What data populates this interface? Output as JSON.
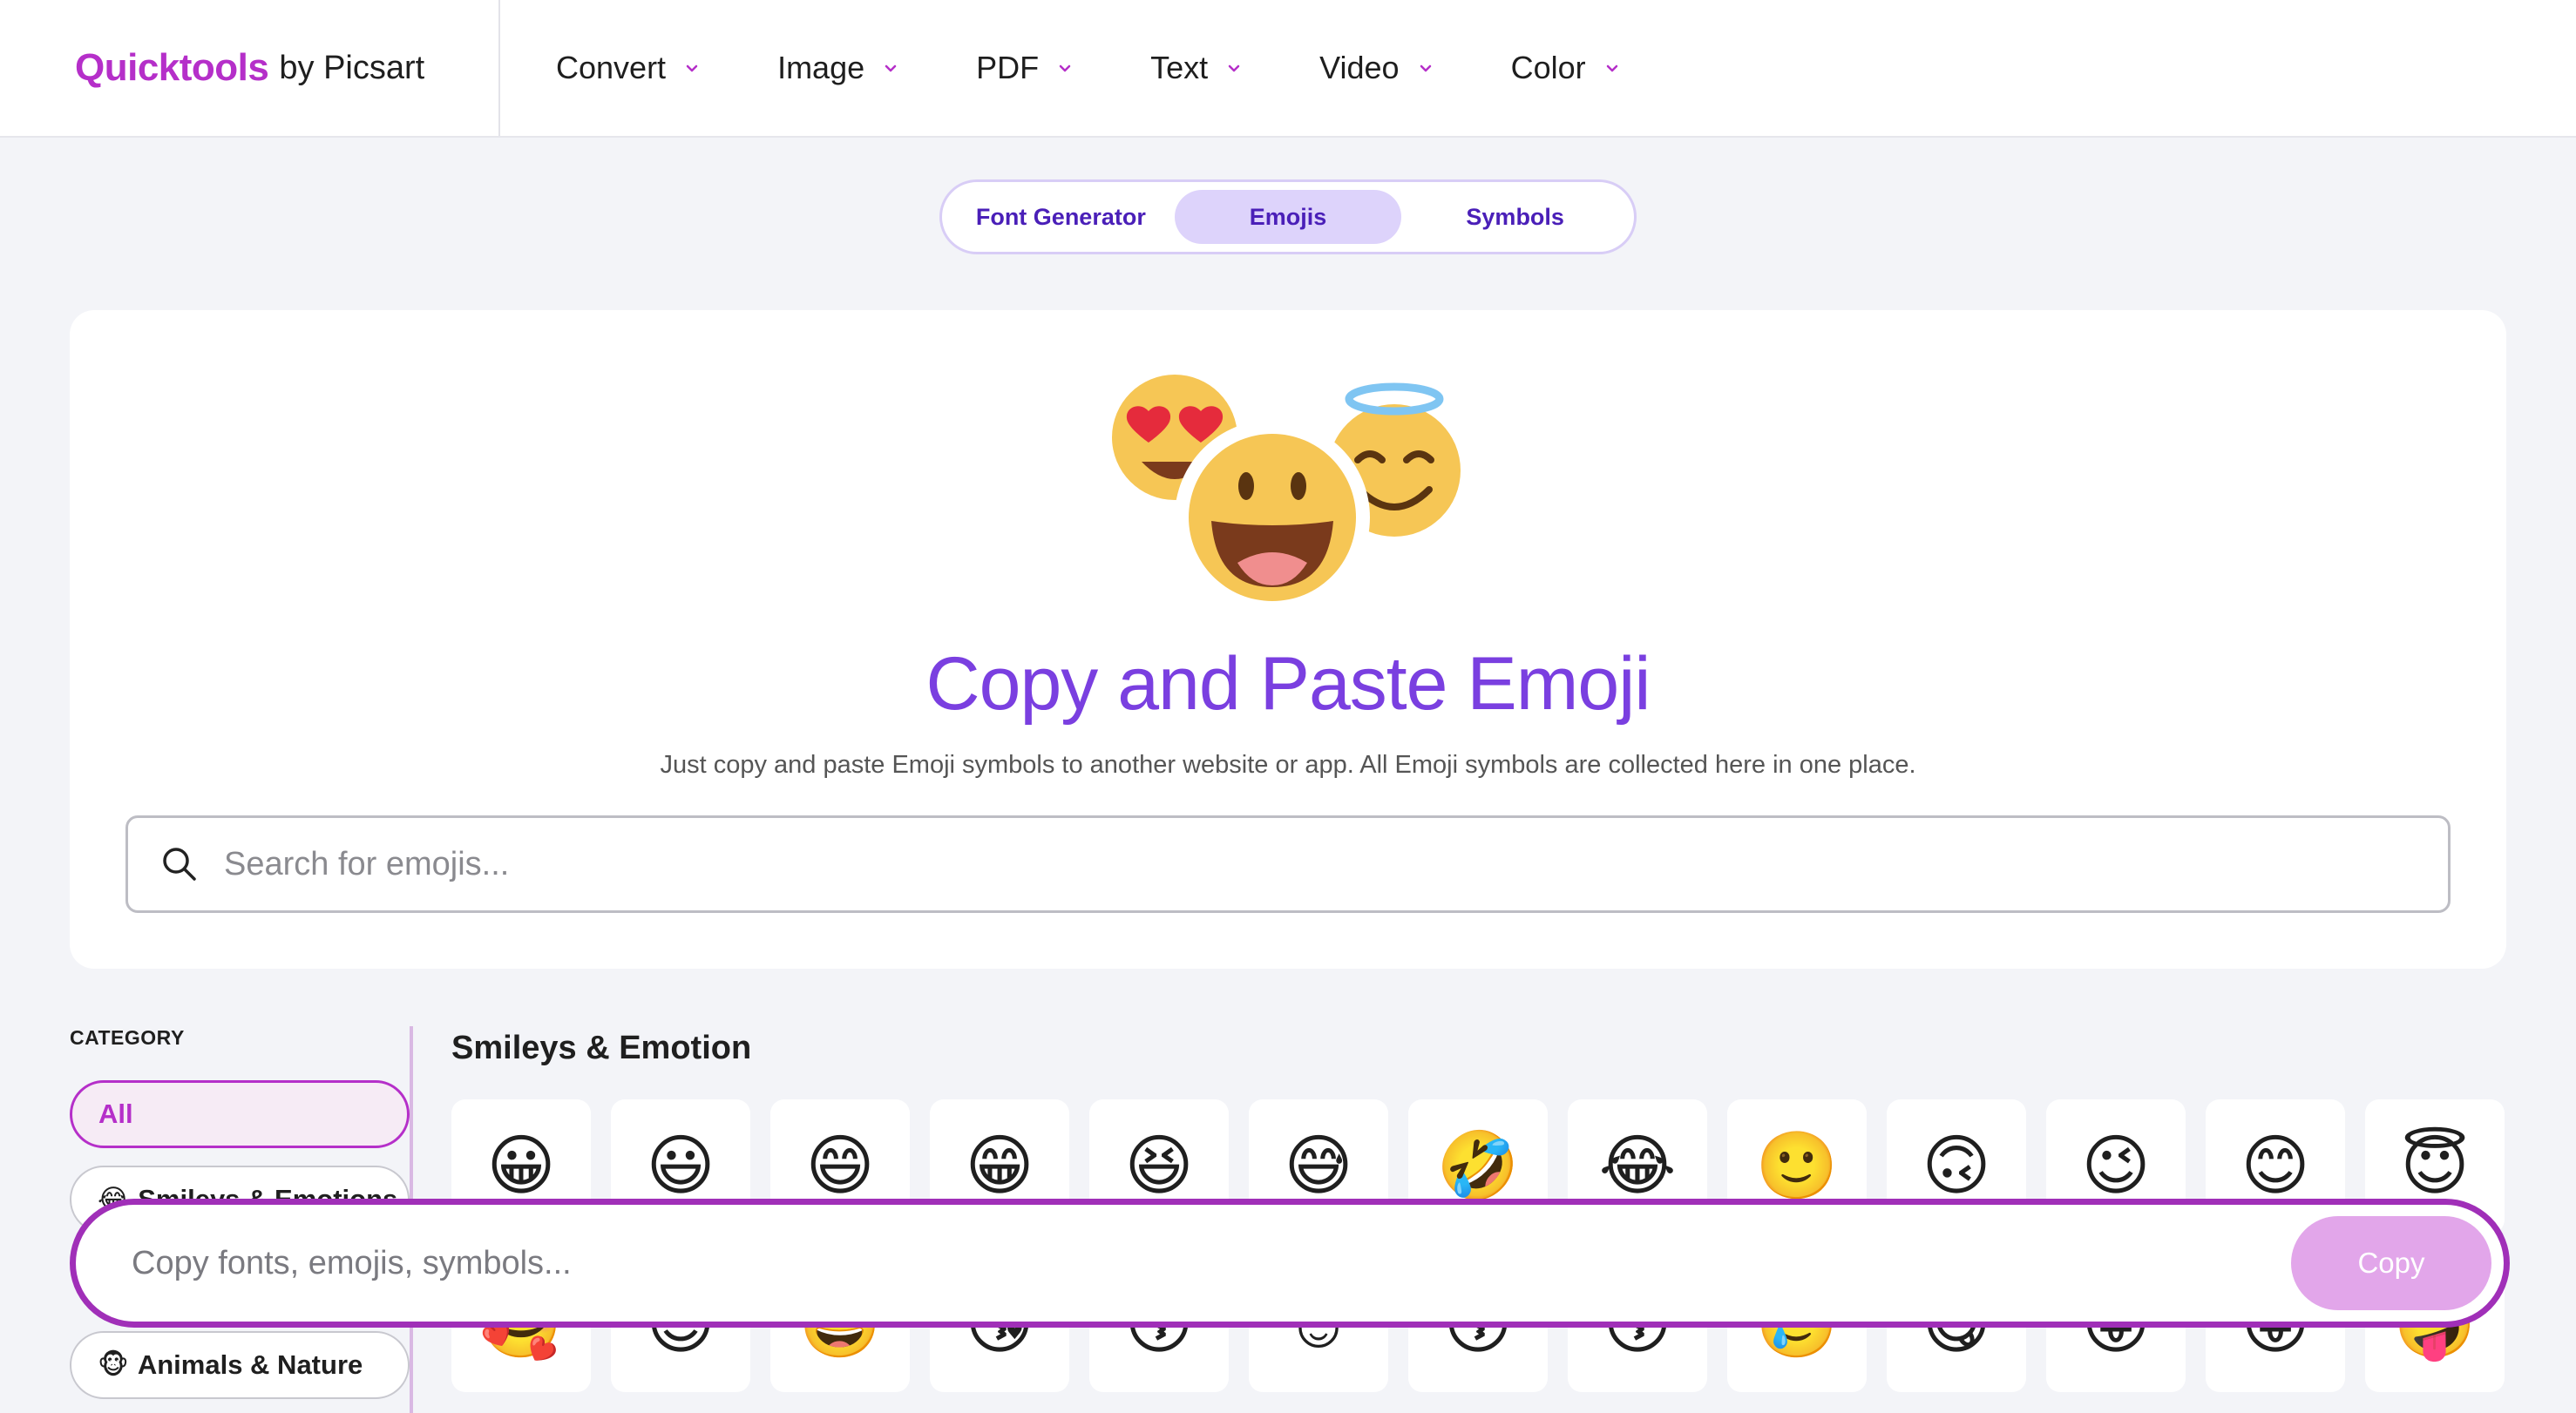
{
  "brand": {
    "name": "Quicktools",
    "by": "by Picsart",
    "color": "#b52fc9"
  },
  "nav": [
    {
      "label": "Convert"
    },
    {
      "label": "Image"
    },
    {
      "label": "PDF"
    },
    {
      "label": "Text"
    },
    {
      "label": "Video"
    },
    {
      "label": "Color"
    }
  ],
  "tabs": [
    {
      "label": "Font Generator",
      "active": false
    },
    {
      "label": "Emojis",
      "active": true
    },
    {
      "label": "Symbols",
      "active": false
    }
  ],
  "hero": {
    "title": "Copy and Paste Emoji",
    "subtitle": "Just copy and paste Emoji symbols to another website or app. All Emoji symbols are collected here in one place.",
    "search_placeholder": "Search for emojis..."
  },
  "sidebar": {
    "label": "CATEGORY",
    "items": [
      {
        "label": "All",
        "emoji": "",
        "active": true
      },
      {
        "label": "Smileys & Emotions",
        "emoji": "😂",
        "active": false
      },
      {
        "label": "Animals & Nature",
        "emoji": "🐵",
        "active": false
      }
    ]
  },
  "section": {
    "title": "Smileys & Emotion"
  },
  "emojis": {
    "row1": [
      "😀",
      "😃",
      "😄",
      "😁",
      "😆",
      "😅",
      "🤣",
      "😂",
      "🙂",
      "🙃",
      "😉",
      "😊",
      "😇"
    ],
    "row2": [
      "🥰",
      "😍",
      "🤩",
      "😘",
      "😗",
      "☺",
      "😚",
      "😙",
      "🥲",
      "😋",
      "😛",
      "😜",
      "🤪"
    ]
  },
  "copybar": {
    "placeholder": "Copy fonts, emojis, symbols...",
    "button": "Copy"
  },
  "colors": {
    "accent": "#7a3fe0",
    "tab_active": "#ddd3fb",
    "copy_border": "#a02fb8",
    "copy_button": "#e2a6ea"
  }
}
